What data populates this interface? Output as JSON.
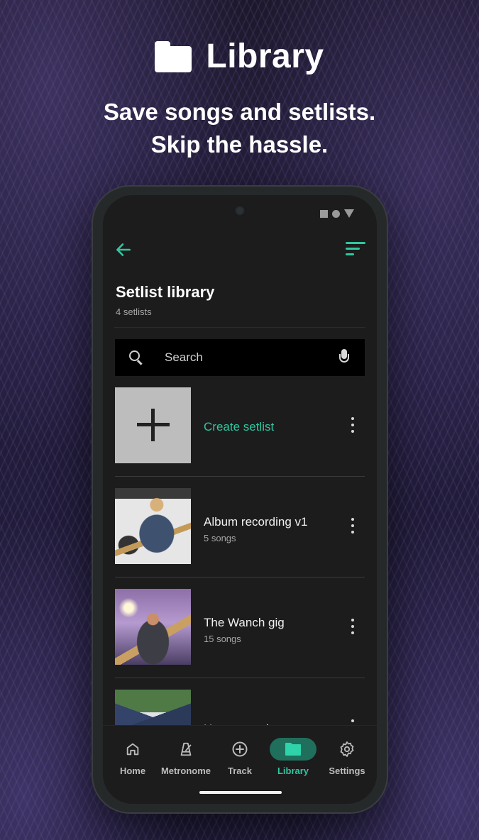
{
  "hero": {
    "icon": "folder-icon",
    "title": "Library",
    "subtitle_line1": "Save songs and setlists.",
    "subtitle_line2": "Skip the hassle."
  },
  "status_bar": {
    "icons": [
      "square-icon",
      "circle-icon",
      "triangle-icon"
    ]
  },
  "toolbar": {
    "back_icon": "arrow-left-icon",
    "sort_icon": "sort-icon"
  },
  "page": {
    "title": "Setlist library",
    "count": "4 setlists"
  },
  "search": {
    "placeholder": "Search",
    "value": "",
    "mic_icon": "microphone-icon"
  },
  "setlists": [
    {
      "name": "Create setlist",
      "meta": "",
      "thumb": "plus-icon",
      "action": true
    },
    {
      "name": "Album recording v1",
      "meta": "5 songs",
      "thumb": "album-photo"
    },
    {
      "name": "The Wanch gig",
      "meta": "15 songs",
      "thumb": "gig-photo"
    },
    {
      "name": "Home practice",
      "meta": "",
      "thumb": "house-photo"
    }
  ],
  "nav": {
    "items": [
      {
        "label": "Home",
        "icon": "home-icon",
        "active": false
      },
      {
        "label": "Metronome",
        "icon": "metronome-icon",
        "active": false
      },
      {
        "label": "Track",
        "icon": "plus-circle-icon",
        "active": false
      },
      {
        "label": "Library",
        "icon": "folder-icon",
        "active": true
      },
      {
        "label": "Settings",
        "icon": "gear-icon",
        "active": false
      }
    ]
  },
  "colors": {
    "accent": "#2fc7a0",
    "accent_pill": "#1f6f5c",
    "screen_bg": "#1c1c1c"
  }
}
